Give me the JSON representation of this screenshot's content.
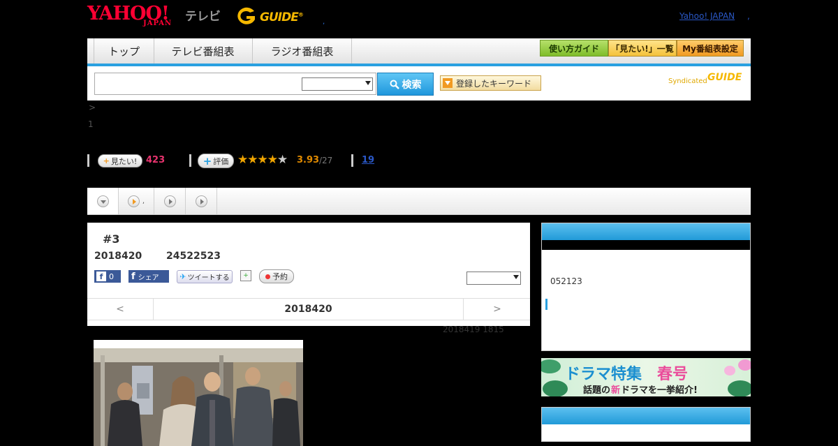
{
  "header": {
    "yahoo_logo": "YAHOO!",
    "japan_logo": "JAPAN",
    "tv_logo": "テレビ",
    "guide_logo": "GUIDE",
    "small_dot": ",",
    "yahoo_japan_link": "Yahoo! JAPAN",
    "link_sep": ","
  },
  "nav": {
    "tabs": [
      {
        "label": "トップ"
      },
      {
        "label": "テレビ番組表"
      },
      {
        "label": "ラジオ番組表"
      }
    ],
    "buttons": [
      {
        "label": "使い方ガイド"
      },
      {
        "label": "「見たい!」一覧"
      },
      {
        "label": "My番組表設定"
      }
    ]
  },
  "search": {
    "input_value": "",
    "select_value": "",
    "button_label": "検索",
    "keyword_button": "登録したキーワード",
    "syndicated_label": "Syndicated",
    "syndicated_guide": "GUIDE"
  },
  "breadcrumb": ">",
  "page_number": "1",
  "rating": {
    "want_label": "見たい!",
    "want_count": "423",
    "eval_label": "評価",
    "stars_value": 3.93,
    "rating_value": "3.93",
    "rating_count": "/27",
    "review_count": "19"
  },
  "tabs": {
    "second_tab_dot": ","
  },
  "program": {
    "episode": "#3",
    "date": "2018420",
    "time": "24522523",
    "fb_like_count": "0",
    "fb_share_label": "シェア",
    "tweet_label": "ツイートする",
    "reserve_label": "予約",
    "select_value": "",
    "nav_prev": "<",
    "nav_date": "2018420",
    "nav_next": ">",
    "updated": "2018419  1815"
  },
  "sidebar": {
    "box1_text": "052123"
  },
  "banner": {
    "title_main": "ドラマ特集",
    "title_accent": "春号",
    "subtitle_pre": "話題の",
    "subtitle_new": "新",
    "subtitle_post": "ドラマを一挙紹介!"
  },
  "colors": {
    "accent_blue": "#2aa0e0",
    "rating_orange": "#e08a00",
    "want_pink": "#e8336e",
    "yahoo_red": "#ff0033",
    "guide_yellow": "#f5b800"
  }
}
